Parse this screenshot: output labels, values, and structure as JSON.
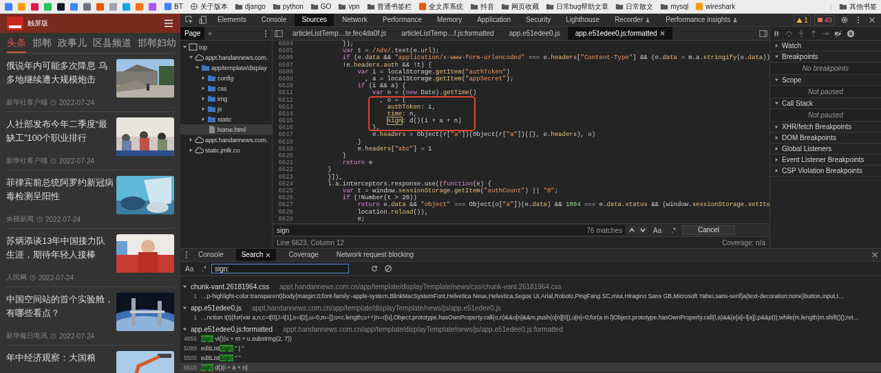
{
  "bookmarks_bar": {
    "items": [
      {
        "label": "BT",
        "kind": "site"
      },
      {
        "label": "关于版本",
        "kind": "page"
      },
      {
        "label": "django",
        "kind": "folder"
      },
      {
        "label": "python",
        "kind": "folder"
      },
      {
        "label": "GO",
        "kind": "folder"
      },
      {
        "label": "vpn",
        "kind": "folder"
      },
      {
        "label": "普通书签栏",
        "kind": "folder"
      },
      {
        "label": "全文库系统",
        "kind": "site"
      },
      {
        "label": "抖音",
        "kind": "folder"
      },
      {
        "label": "网页收藏",
        "kind": "folder"
      },
      {
        "label": "日常bug帮助文章",
        "kind": "folder"
      },
      {
        "label": "日常散文",
        "kind": "folder"
      },
      {
        "label": "mysql",
        "kind": "folder"
      },
      {
        "label": "wireshark",
        "kind": "site"
      }
    ],
    "other": "其他书签"
  },
  "mobile_page": {
    "header": {
      "edition": "触屏版"
    },
    "tabs": [
      {
        "label": "头条",
        "selected": true
      },
      {
        "label": "邯郸",
        "selected": false
      },
      {
        "label": "政事儿",
        "selected": false
      },
      {
        "label": "区县频道",
        "selected": false
      },
      {
        "label": "邯郸妇幼",
        "selected": false
      }
    ],
    "articles": [
      {
        "title": "俄说年内可能多次降息 乌多地继续遭大规模炮击",
        "source": "新华社客户端",
        "date": "2022-07-24"
      },
      {
        "title": "人社部发布今年二季度“最缺工”100个职业排行",
        "source": "新华社客户端",
        "date": "2022-07-24"
      },
      {
        "title": "菲律宾前总统阿罗约新冠病毒检测呈阳性",
        "source": "央视新闻",
        "date": "2022-07-24"
      },
      {
        "title": "苏炳添谈13年中国接力队生涯，期待年轻人接棒",
        "source": "人民网",
        "date": "2022-07-24"
      },
      {
        "title": "中国空间站的首个实验舱，有哪些看点？",
        "source": "新华每日电讯",
        "date": "2022-07-24"
      },
      {
        "title": "年中经济观察：大国粮"
      }
    ]
  },
  "devtools": {
    "tabs": [
      {
        "label": "Elements",
        "selected": false,
        "experimental": false
      },
      {
        "label": "Console",
        "selected": false,
        "experimental": false
      },
      {
        "label": "Sources",
        "selected": true,
        "experimental": false
      },
      {
        "label": "Network",
        "selected": false,
        "experimental": false
      },
      {
        "label": "Performance",
        "selected": false,
        "experimental": false
      },
      {
        "label": "Memory",
        "selected": false,
        "experimental": false
      },
      {
        "label": "Application",
        "selected": false,
        "experimental": false
      },
      {
        "label": "Security",
        "selected": false,
        "experimental": false
      },
      {
        "label": "Lighthouse",
        "selected": false,
        "experimental": false
      },
      {
        "label": "Recorder",
        "selected": false,
        "experimental": true
      },
      {
        "label": "Performance insights",
        "selected": false,
        "experimental": true
      }
    ],
    "warnings": "1",
    "errors": "49"
  },
  "sources": {
    "navigator": {
      "tabs": [
        {
          "label": "Page",
          "selected": true
        }
      ],
      "more": "»",
      "tree": [
        {
          "label": "top",
          "kind": "frame",
          "expanded": true,
          "selected": false,
          "children": [
            {
              "label": "appt.handannews.com.",
              "kind": "domain",
              "expanded": true,
              "selected": false,
              "children": [
                {
                  "label": "app/template/display",
                  "kind": "folder",
                  "expanded": true,
                  "selected": false,
                  "children": [
                    {
                      "label": "config",
                      "kind": "folder",
                      "expanded": false,
                      "selected": false
                    },
                    {
                      "label": "css",
                      "kind": "folder",
                      "expanded": false,
                      "selected": false
                    },
                    {
                      "label": "img",
                      "kind": "folder",
                      "expanded": false,
                      "selected": false
                    },
                    {
                      "label": "js",
                      "kind": "folder",
                      "expanded": false,
                      "selected": false
                    },
                    {
                      "label": "static",
                      "kind": "folder",
                      "expanded": false,
                      "selected": false
                    },
                    {
                      "label": "home.html",
                      "kind": "file",
                      "selected": true
                    }
                  ]
                }
              ]
            },
            {
              "label": "appt.handannews.com.",
              "kind": "domain",
              "expanded": false,
              "selected": false
            },
            {
              "label": "static.jmlk.co",
              "kind": "domain",
              "expanded": false,
              "selected": false
            }
          ]
        }
      ]
    },
    "editor_tabs": [
      {
        "label": "articleListTemp…te.fec4da0f.js",
        "selected": false
      },
      {
        "label": "articleListTemp…f.js:formatted",
        "selected": false
      },
      {
        "label": "app.e51edee0.js",
        "selected": false
      },
      {
        "label": "app.e51edee0.js:formatted",
        "selected": true
      }
    ],
    "code_lines": [
      {
        "number": "6604",
        "tokens": [
          {
            "kind": "plain",
            "text": "            });"
          }
        ]
      },
      {
        "number": "6605",
        "tokens": [
          {
            "kind": "keyword",
            "text": "            var"
          },
          {
            "kind": "plain",
            "text": " t = "
          },
          {
            "kind": "string",
            "text": "/Adv/"
          },
          {
            "kind": "plain",
            "text": ".test(e."
          },
          {
            "kind": "property",
            "text": "url"
          },
          {
            "kind": "plain",
            "text": ");"
          }
        ]
      },
      {
        "number": "6606",
        "tokens": [
          {
            "kind": "keyword",
            "text": "            if"
          },
          {
            "kind": "plain",
            "text": " (e."
          },
          {
            "kind": "property",
            "text": "data"
          },
          {
            "kind": "plain",
            "text": " && "
          },
          {
            "kind": "string",
            "text": "\"application/x-www-form-urlencoded\""
          },
          {
            "kind": "plain",
            "text": " === e."
          },
          {
            "kind": "property",
            "text": "headers"
          },
          {
            "kind": "plain",
            "text": "["
          },
          {
            "kind": "string",
            "text": "\"Content-Type\""
          },
          {
            "kind": "plain",
            "text": "] && (e."
          },
          {
            "kind": "property",
            "text": "data"
          },
          {
            "kind": "plain",
            "text": " = m.a."
          },
          {
            "kind": "property",
            "text": "stringify"
          },
          {
            "kind": "plain",
            "text": "(e."
          },
          {
            "kind": "property",
            "text": "data"
          },
          {
            "kind": "plain",
            "text": "))"
          }
        ]
      },
      {
        "number": "6607",
        "tokens": [
          {
            "kind": "plain",
            "text": "            !e."
          },
          {
            "kind": "property",
            "text": "headers"
          },
          {
            "kind": "plain",
            "text": "."
          },
          {
            "kind": "property",
            "text": "auth"
          },
          {
            "kind": "plain",
            "text": " && !t) {"
          }
        ]
      },
      {
        "number": "6608",
        "tokens": [
          {
            "kind": "keyword",
            "text": "                var"
          },
          {
            "kind": "plain",
            "text": " i = localStorage."
          },
          {
            "kind": "property",
            "text": "getItem"
          },
          {
            "kind": "plain",
            "text": "("
          },
          {
            "kind": "string",
            "text": "\"authToken\""
          },
          {
            "kind": "plain",
            "text": ")"
          }
        ]
      },
      {
        "number": "6609",
        "tokens": [
          {
            "kind": "plain",
            "text": "                  , a = localStorage."
          },
          {
            "kind": "property",
            "text": "getItem"
          },
          {
            "kind": "plain",
            "text": "("
          },
          {
            "kind": "string",
            "text": "\"appSecret\""
          },
          {
            "kind": "plain",
            "text": ");"
          }
        ]
      },
      {
        "number": "6610",
        "tokens": [
          {
            "kind": "keyword",
            "text": "                if"
          },
          {
            "kind": "plain",
            "text": " (i && a) {"
          }
        ]
      },
      {
        "number": "6611",
        "tokens": [
          {
            "kind": "keyword",
            "text": "                    var"
          },
          {
            "kind": "plain",
            "text": " n = ("
          },
          {
            "kind": "keyword",
            "text": "new"
          },
          {
            "kind": "plain",
            "text": " Date)."
          },
          {
            "kind": "property",
            "text": "getTime"
          },
          {
            "kind": "plain",
            "text": "()"
          }
        ]
      },
      {
        "number": "6612",
        "tokens": [
          {
            "kind": "plain",
            "text": "                      , o = {"
          }
        ]
      },
      {
        "number": "6613",
        "tokens": [
          {
            "kind": "property",
            "text": "                        authToken"
          },
          {
            "kind": "plain",
            "text": ": i,"
          }
        ]
      },
      {
        "number": "6614",
        "tokens": [
          {
            "kind": "property",
            "text": "                        time"
          },
          {
            "kind": "plain",
            "text": ": n,"
          }
        ]
      },
      {
        "number": "6615",
        "tokens": [
          {
            "kind": "match",
            "text": "                        sign"
          },
          {
            "kind": "plain",
            "text": ": d()(i + a + n)"
          }
        ]
      },
      {
        "number": "6616",
        "tokens": [
          {
            "kind": "plain",
            "text": "                    },"
          }
        ]
      },
      {
        "number": "6617",
        "tokens": [
          {
            "kind": "plain",
            "text": "                    e."
          },
          {
            "kind": "property",
            "text": "headers"
          },
          {
            "kind": "plain",
            "text": " = Object(r["
          },
          {
            "kind": "string",
            "text": "\"a\""
          },
          {
            "kind": "plain",
            "text": "])(Object(r["
          },
          {
            "kind": "string",
            "text": "\"a\""
          },
          {
            "kind": "plain",
            "text": "])({}, e."
          },
          {
            "kind": "property",
            "text": "headers"
          },
          {
            "kind": "plain",
            "text": "), o)"
          }
        ]
      },
      {
        "number": "6618",
        "tokens": [
          {
            "kind": "plain",
            "text": "                }"
          }
        ]
      },
      {
        "number": "6619",
        "tokens": [
          {
            "kind": "plain",
            "text": "                e."
          },
          {
            "kind": "property",
            "text": "headers"
          },
          {
            "kind": "plain",
            "text": "["
          },
          {
            "kind": "string",
            "text": "\"abc\""
          },
          {
            "kind": "plain",
            "text": "] = 1"
          }
        ]
      },
      {
        "number": "6620",
        "tokens": [
          {
            "kind": "plain",
            "text": "            }"
          }
        ]
      },
      {
        "number": "6621",
        "tokens": [
          {
            "kind": "keyword",
            "text": "            return"
          },
          {
            "kind": "plain",
            "text": " e"
          }
        ]
      },
      {
        "number": "6622",
        "tokens": [
          {
            "kind": "plain",
            "text": "        }"
          }
        ]
      },
      {
        "number": "6623",
        "tokens": [
          {
            "kind": "plain",
            "text": "        }]),"
          }
        ]
      },
      {
        "number": "6624",
        "tokens": [
          {
            "kind": "plain",
            "text": "        l.a.interceptors.response.use(("
          },
          {
            "kind": "keyword",
            "text": "function"
          },
          {
            "kind": "plain",
            "text": "(e) {"
          }
        ]
      },
      {
        "number": "6625",
        "tokens": [
          {
            "kind": "keyword",
            "text": "            var"
          },
          {
            "kind": "plain",
            "text": " t = window."
          },
          {
            "kind": "property",
            "text": "sessionStorage"
          },
          {
            "kind": "plain",
            "text": "."
          },
          {
            "kind": "property",
            "text": "getItem"
          },
          {
            "kind": "plain",
            "text": "("
          },
          {
            "kind": "string",
            "text": "\"authCount\""
          },
          {
            "kind": "plain",
            "text": ") || "
          },
          {
            "kind": "string",
            "text": "\"0\""
          },
          {
            "kind": "plain",
            "text": ";"
          }
        ]
      },
      {
        "number": "6626",
        "tokens": [
          {
            "kind": "keyword",
            "text": "            if"
          },
          {
            "kind": "plain",
            "text": " (!Number(t > 20))"
          }
        ]
      },
      {
        "number": "6627",
        "tokens": [
          {
            "kind": "keyword",
            "text": "                return"
          },
          {
            "kind": "plain",
            "text": " e."
          },
          {
            "kind": "property",
            "text": "data"
          },
          {
            "kind": "plain",
            "text": " && "
          },
          {
            "kind": "string",
            "text": "\"object\""
          },
          {
            "kind": "plain",
            "text": " === Object(o["
          },
          {
            "kind": "string",
            "text": "\"a\""
          },
          {
            "kind": "plain",
            "text": "])(e."
          },
          {
            "kind": "property",
            "text": "data"
          },
          {
            "kind": "plain",
            "text": ") && "
          },
          {
            "kind": "number",
            "text": "1004"
          },
          {
            "kind": "plain",
            "text": " === e."
          },
          {
            "kind": "property",
            "text": "data"
          },
          {
            "kind": "plain",
            "text": "."
          },
          {
            "kind": "property",
            "text": "status"
          },
          {
            "kind": "plain",
            "text": " && (window."
          },
          {
            "kind": "property",
            "text": "sessionStorage"
          },
          {
            "kind": "plain",
            "text": "."
          },
          {
            "kind": "property",
            "text": "setIte"
          }
        ]
      },
      {
        "number": "6628",
        "tokens": [
          {
            "kind": "plain",
            "text": "                location."
          },
          {
            "kind": "property",
            "text": "reload"
          },
          {
            "kind": "plain",
            "text": "()),"
          }
        ]
      },
      {
        "number": "6629",
        "tokens": [
          {
            "kind": "plain",
            "text": "                e;"
          }
        ]
      }
    ],
    "find_bar": {
      "query": "sign",
      "count": "76 matches",
      "case_label": "Aa",
      "regex_label": ".*",
      "cancel": "Cancel"
    },
    "status": {
      "position": "Line 6623, Column 12",
      "coverage": "Coverage: n/a"
    },
    "sidebar": [
      {
        "label": "Watch",
        "expanded": false
      },
      {
        "label": "Breakpoints",
        "expanded": true,
        "message": "No breakpoints"
      },
      {
        "label": "Scope",
        "expanded": true,
        "message": "Not paused"
      },
      {
        "label": "Call Stack",
        "expanded": true,
        "message": "Not paused"
      },
      {
        "label": "XHR/fetch Breakpoints",
        "expanded": false
      },
      {
        "label": "DOM Breakpoints",
        "expanded": false
      },
      {
        "label": "Global Listeners",
        "expanded": false
      },
      {
        "label": "Event Listener Breakpoints",
        "expanded": false
      },
      {
        "label": "CSP Violation Breakpoints",
        "expanded": false
      }
    ]
  },
  "drawer": {
    "tabs": [
      {
        "label": "Console",
        "selected": false
      },
      {
        "label": "Search",
        "selected": true
      },
      {
        "label": "Coverage",
        "selected": false
      },
      {
        "label": "Network request blocking",
        "selected": false
      }
    ],
    "search": {
      "case_label": "Aa",
      "regex_label": ".*",
      "query": "sign:"
    },
    "results": [
      {
        "file": "chunk-vant.26181964.css",
        "path": "appt.handannews.com.cn/app/template/displayTemplate/news/css/chunk-vant.26181964.css",
        "expanded": true,
        "matches": [
          {
            "line": "1",
            "selected": false,
            "segments": [
              {
                "text": "…p-highlight-color:transparent}body{margin:0;font-family:-apple-system,BlinkMacSystemFont,Helvetica Neue,Helvetica,Segoe UI,Arial,Roboto,PingFang SC,miui,Hiragino Sans GB,Microsoft Yahei,sans-serif}a{text-decoration:none}button,input,t…",
                "match": false
              }
            ]
          }
        ]
      },
      {
        "file": "app.e51edee0.js",
        "path": "appt.handannews.com.cn/app/template/displayTemplate/news/js/app.e51edee0.js",
        "expanded": true,
        "matches": [
          {
            "line": "1",
            "selected": false,
            "segments": [
              {
                "text": "…nction t(t){for(var a,n,c=t[0],l=t[1],s=t[2],u=0,m=[];u<c.length;u++)n=c[u],Object.prototype.hasOwnProperty.call(o,n)&&o[n]&&m.push(o[n][0]),o[n]=0;for(a in l)Object.prototype.hasOwnProperty.call(l,a)&&(e[a]=l[a]);p&&p(t);while(m.length)m.shift()();ret…",
                "match": false
              }
            ]
          }
        ]
      },
      {
        "file": "app.e51edee0.js:formatted",
        "path": "appt.handannews.com.cn/app/template/displayTemplate/news/js/app.e51edee0.js:formatted",
        "expanded": true,
        "matches": [
          {
            "line": "4656",
            "selected": false,
            "segments": [
              {
                "text": "sign:",
                "match": true
              },
              {
                "text": " vi()(u + m + u.substring(2, 7))",
                "match": false
              }
            ]
          },
          {
            "line": "5089",
            "selected": false,
            "segments": [
              {
                "text": "editList",
                "match": false
              },
              {
                "text": "Sign:",
                "match": true
              },
              {
                "text": " \" | \"",
                "match": false
              }
            ]
          },
          {
            "line": "5500",
            "selected": false,
            "segments": [
              {
                "text": "editList",
                "match": false
              },
              {
                "text": "Sign:",
                "match": true
              },
              {
                "text": " \" \"",
                "match": false
              }
            ]
          },
          {
            "line": "6615",
            "selected": true,
            "segments": [
              {
                "text": "sign:",
                "match": true
              },
              {
                "text": " d()(i + a + n)",
                "match": false
              }
            ]
          }
        ]
      }
    ]
  }
}
